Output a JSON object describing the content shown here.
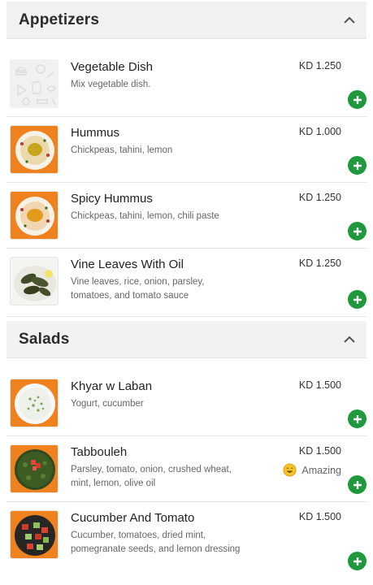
{
  "sections": [
    {
      "title": "Appetizers",
      "items": [
        {
          "name": "Vegetable Dish",
          "description": "Mix vegetable dish.",
          "price": "KD 1.250"
        },
        {
          "name": "Hummus",
          "description": "Chickpeas, tahini, lemon",
          "price": "KD 1.000"
        },
        {
          "name": "Spicy Hummus",
          "description": "Chickpeas, tahini, lemon, chili paste",
          "price": "KD 1.250"
        },
        {
          "name": "Vine Leaves With Oil",
          "description": "Vine leaves, rice, onion, parsley, tomatoes, and tomato sauce",
          "price": "KD 1.250"
        }
      ]
    },
    {
      "title": "Salads",
      "items": [
        {
          "name": "Khyar w Laban",
          "description": "Yogurt, cucumber",
          "price": "KD 1.500"
        },
        {
          "name": "Tabbouleh",
          "description": "Parsley, tomato, onion, crushed wheat, mint, lemon, olive oil",
          "price": "KD 1.500",
          "badge": "Amazing"
        },
        {
          "name": "Cucumber And Tomato",
          "description": "Cucumber, tomatoes, dried mint, pomegranate seeds, and lemon dressing",
          "price": "KD 1.500"
        }
      ]
    }
  ],
  "colors": {
    "accent": "#1e9a3c",
    "thumb_bg": "#f0811f",
    "header_bg": "#f2f2f2"
  },
  "icons": {
    "collapse": "chevron-up-icon",
    "add": "plus-icon",
    "badge": "smiley-icon"
  }
}
